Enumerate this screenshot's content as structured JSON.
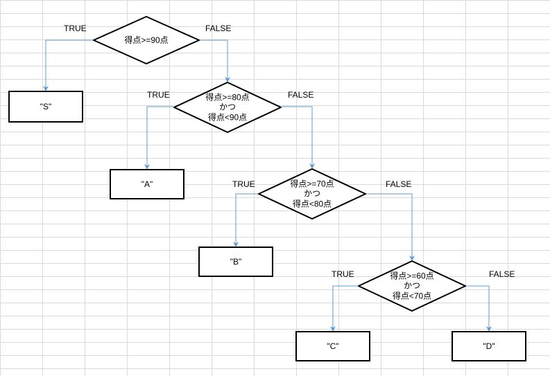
{
  "chart_data": {
    "type": "flowchart",
    "decisions": [
      {
        "id": "d1",
        "condition": "得点>=90点",
        "true_result": "\"S\"",
        "false_next": "d2"
      },
      {
        "id": "d2",
        "condition": "得点>=80点\nかつ\n得点<90点",
        "true_result": "\"A\"",
        "false_next": "d3"
      },
      {
        "id": "d3",
        "condition": "得点>=70点\nかつ\n得点<80点",
        "true_result": "\"B\"",
        "false_next": "d4"
      },
      {
        "id": "d4",
        "condition": "得点>=60点\nかつ\n得点<70点",
        "true_result": "\"C\"",
        "false_result": "\"D\""
      }
    ]
  },
  "labels": {
    "true": "TRUE",
    "false": "FALSE"
  },
  "d1_cond": "得点>=90点",
  "d2_cond": "得点>=80点\nかつ\n得点<90点",
  "d3_cond": "得点>=70点\nかつ\n得点<80点",
  "d4_cond": "得点>=60点\nかつ\n得点<70点",
  "res_s": "\"S\"",
  "res_a": "\"A\"",
  "res_b": "\"B\"",
  "res_c": "\"C\"",
  "res_d": "\"D\""
}
